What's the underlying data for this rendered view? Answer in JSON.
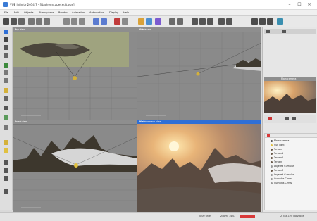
{
  "window": {
    "title": "VUE Infinite 2014.7 - [Dachenscape4edit.vue]"
  },
  "window_controls": {
    "minimize": "–",
    "maximize": "☐",
    "close": "✕"
  },
  "menu": {
    "items": [
      "File",
      "Edit",
      "Objects",
      "Atmosphere",
      "Render",
      "Animation",
      "Automation",
      "Display",
      "Help"
    ]
  },
  "viewports": {
    "top": {
      "label": "Top view"
    },
    "side": {
      "label": "Side view"
    },
    "front": {
      "label": "Front view"
    },
    "main_camera": {
      "label": "Main camera view"
    }
  },
  "right_panel": {
    "preview_label": "Main camera",
    "scene_items": [
      "Main camera",
      "Sun light",
      "Terrain",
      "Terrain1",
      "Terrain2",
      "Terrain",
      "Layered Cumulus",
      "Terrain3",
      "Layered Cumulus",
      "Cumulus Cirrus",
      "Cumulus Cirrus"
    ]
  },
  "status": {
    "units": "0.00 units",
    "zoom": "Zoom: 14%",
    "polygons": "2,784,170 polygons"
  },
  "colors": {
    "selection": "#2f6fd6",
    "sky_top_view": "#9fa37f",
    "status_red": "#d93a3a"
  }
}
